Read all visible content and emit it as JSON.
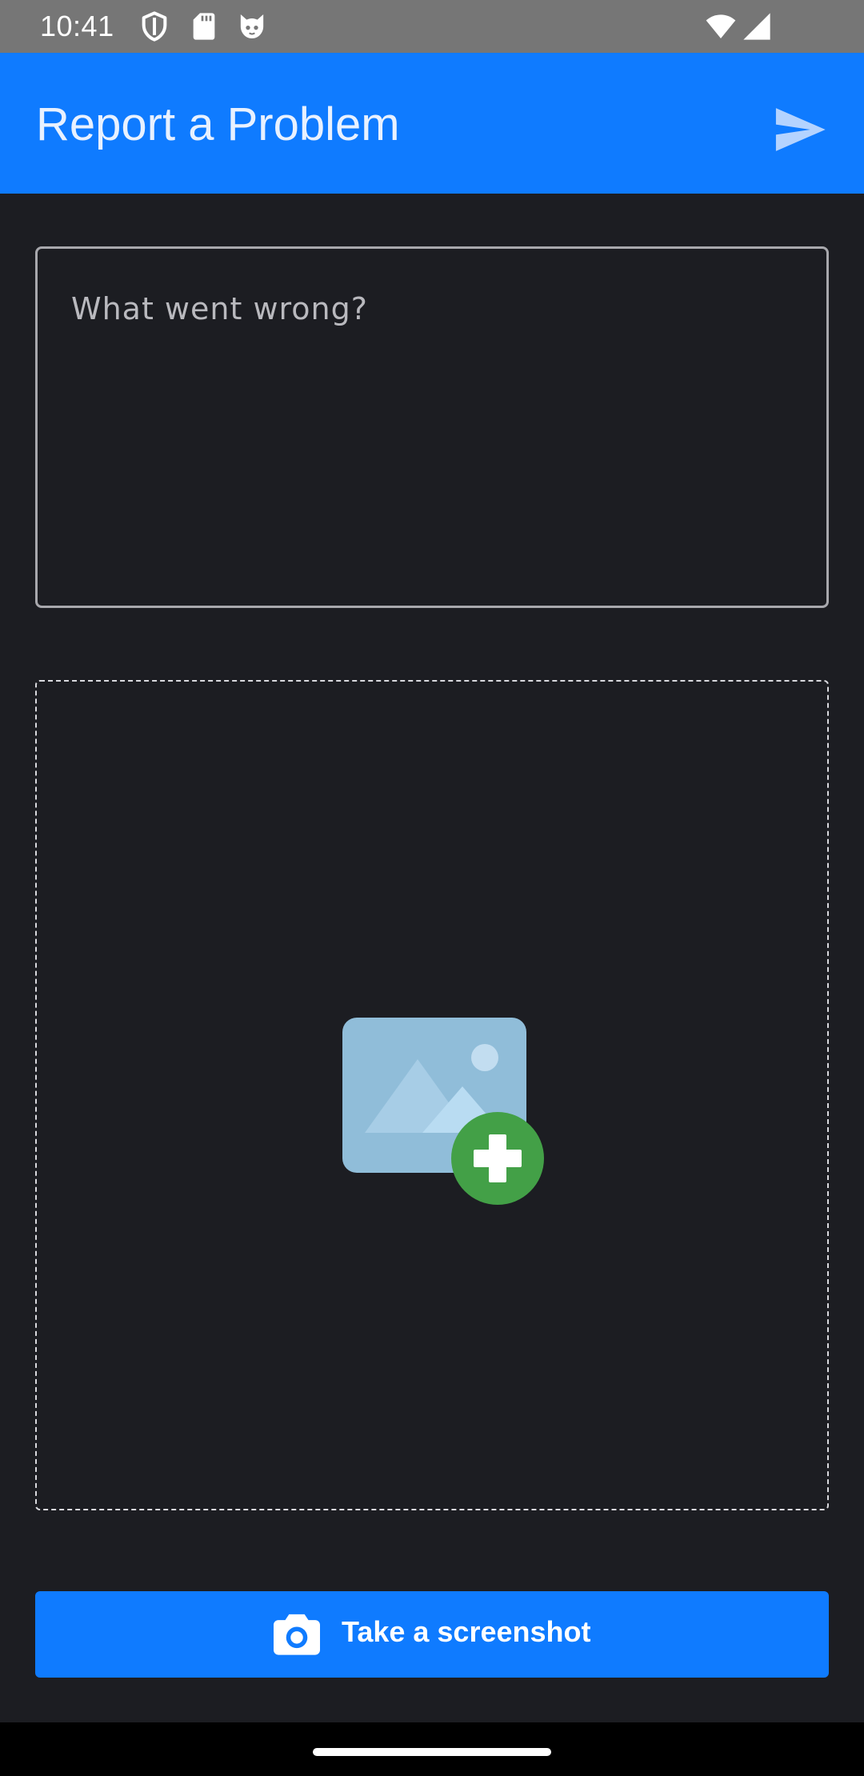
{
  "status_bar": {
    "time": "10:41",
    "icons": [
      "shield-icon",
      "sd-card-icon",
      "cat-face-icon",
      "wifi-icon",
      "cellular-signal-icon"
    ]
  },
  "app_bar": {
    "title": "Report a Problem",
    "action_icon": "send-icon",
    "background_color": "#0f7bff"
  },
  "description": {
    "placeholder": "What went wrong?",
    "value": ""
  },
  "attachment": {
    "icon": "add-image-icon"
  },
  "screenshot_button": {
    "label": "Take a screenshot",
    "icon": "camera-icon"
  },
  "colors": {
    "accent": "#0f7bff",
    "background": "#1c1d22",
    "status_bar": "#767676",
    "add_badge": "#43a047",
    "image_placeholder": "#90bdd9"
  }
}
